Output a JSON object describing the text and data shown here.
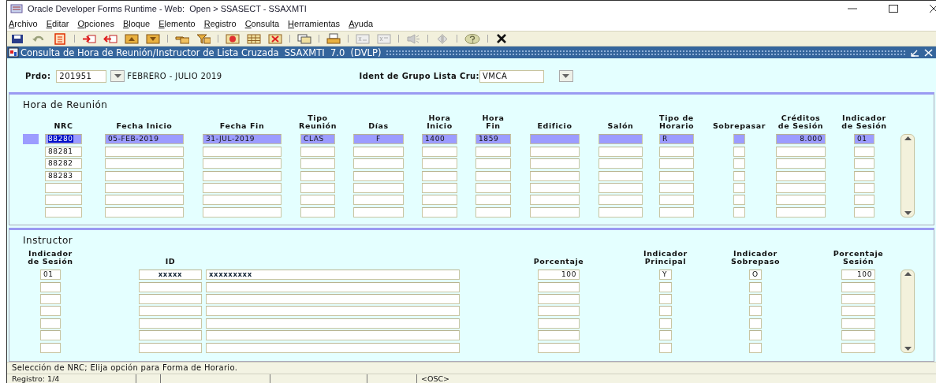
{
  "window": {
    "title": "Oracle Developer Forms Runtime - Web:  Open > SSASECT - SSAXMTI"
  },
  "menu": [
    "Archivo",
    "Editar",
    "Opciones",
    "Bloque",
    "Elemento",
    "Registro",
    "Consulta",
    "Herramientas",
    "Ayuda"
  ],
  "form": {
    "title": "Consulta de Hora de Reunión/Instructor de Lista Cruzada  SSAXMTI  7.0  (DVLP)"
  },
  "key_block": {
    "period_label": "Prdo:",
    "period": "201951",
    "period_description": "FEBRERO - JULIO 2019",
    "group_label": "Ident de Grupo Lista Cru:",
    "group": "VMCA"
  },
  "meeting_times": {
    "title": "Hora de Reunión",
    "columns": [
      "NRC",
      "Fecha Inicio",
      "Fecha Fin",
      "Tipo\nReunión",
      "Días",
      "Hora\nInicio",
      "Hora\nFin",
      "Edificio",
      "Salón",
      "Tipo de\nHorario",
      "Sobrepasar",
      "Créditos\nde Sesión",
      "Indicador\nde Sesión"
    ],
    "rows": [
      {
        "selected": true,
        "cells": [
          "88280",
          "05-FEB-2019",
          "31-JUL-2019",
          "CLAS",
          "F",
          "1400",
          "1859",
          null,
          null,
          "R",
          null,
          "8.000",
          "01"
        ]
      },
      {
        "selected": false,
        "cells": [
          "88281"
        ]
      },
      {
        "selected": false,
        "cells": [
          "88282"
        ]
      },
      {
        "selected": false,
        "cells": [
          "88283"
        ]
      },
      {
        "selected": false,
        "cells": []
      },
      {
        "selected": false,
        "cells": []
      },
      {
        "selected": false,
        "cells": []
      }
    ]
  },
  "instructor": {
    "title": "Instructor",
    "columns": [
      {
        "label": "Indicador\nde Sesión"
      },
      {
        "label": "ID"
      },
      {},
      {
        "label": "Porcentaje"
      },
      {
        "label": "Indicador\nPrincipal"
      },
      {
        "label": "Indicador\nSobrepaso"
      },
      {
        "label": "Porcentaje\nSesión"
      }
    ],
    "rows": [
      {
        "cells": [
          "01",
          "xxxxx",
          "xxxxxxxxx",
          "100",
          "Y",
          "O",
          "100"
        ]
      },
      {
        "cells": []
      },
      {
        "cells": []
      },
      {
        "cells": []
      },
      {
        "cells": []
      },
      {
        "cells": []
      },
      {
        "cells": []
      }
    ]
  },
  "message": "Selección de NRC; Elija opción para Forma de Horario.",
  "status_bar": {
    "record": "Registro: 1/4",
    "mode": "<OSC>"
  }
}
